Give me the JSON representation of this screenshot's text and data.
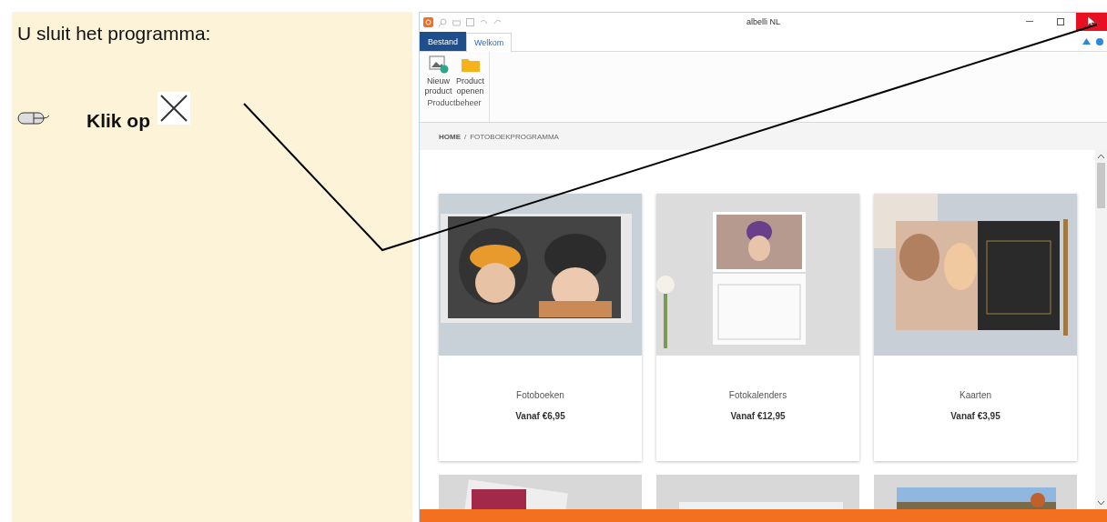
{
  "instruction": {
    "heading": "U sluit het programma:",
    "step": "Klik op"
  },
  "window": {
    "title": "albelli NL",
    "tabs": [
      {
        "label": "Bestand",
        "kind": "file",
        "selected": false
      },
      {
        "label": "Welkom",
        "kind": "tab",
        "selected": true
      }
    ],
    "ribbon": {
      "buttons": [
        {
          "label": "Nieuw product",
          "kind": "new"
        },
        {
          "label": "Product openen",
          "kind": "open"
        }
      ],
      "group": "Productbeheer"
    },
    "breadcrumb": {
      "home": "HOME",
      "separator": "/",
      "current": "FOTOBOEKPROGRAMMA"
    },
    "products": [
      {
        "name": "Fotoboeken",
        "price": "Vanaf €6,95"
      },
      {
        "name": "Fotokalenders",
        "price": "Vanaf €12,95"
      },
      {
        "name": "Kaarten",
        "price": "Vanaf €3,95"
      }
    ]
  }
}
